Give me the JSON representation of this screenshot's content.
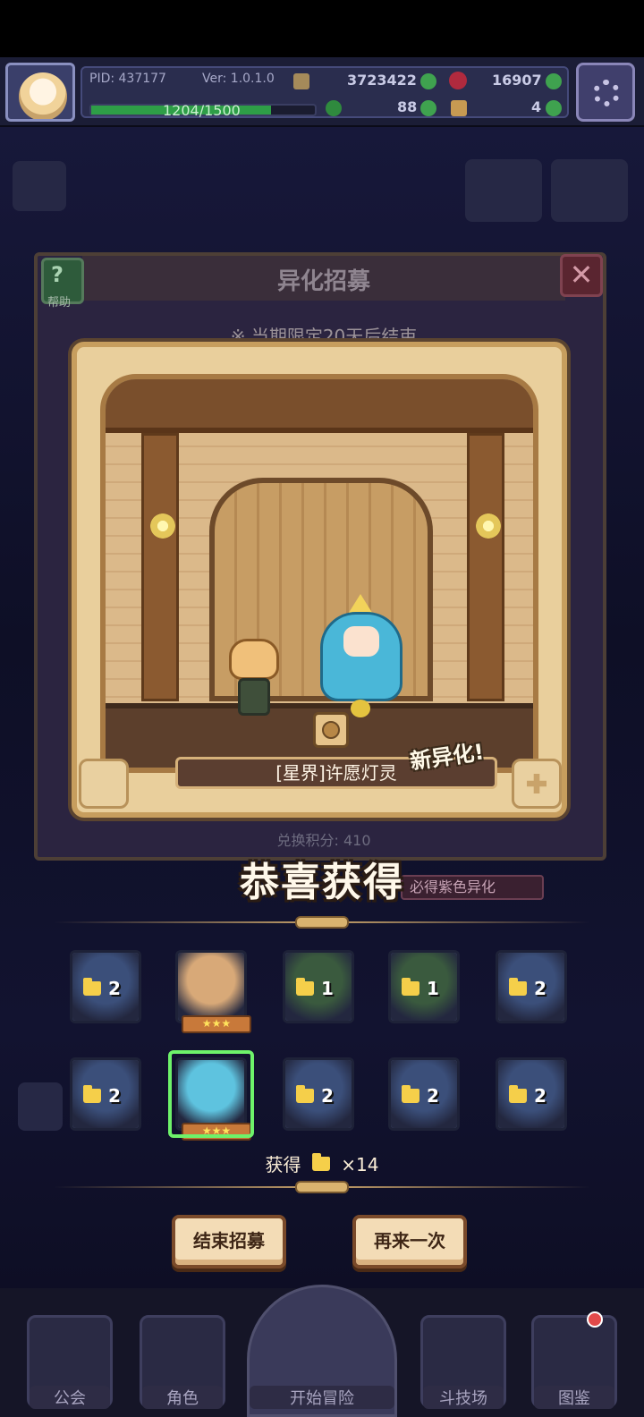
{
  "hud": {
    "pid": "PID: 437177",
    "version": "Ver: 1.0.1.0",
    "gold": "3723422",
    "gems": "16907",
    "exp_text": "1204/1500",
    "exp_progress": 0.8027,
    "clover": "88",
    "key": "4"
  },
  "recruit": {
    "title": "异化招募",
    "help_label": "帮助",
    "close_label": "✕",
    "period": "※ 当期限定20天后结束",
    "exchange_points": "兑换积分: 410",
    "purple_badge": "必得紫色异化"
  },
  "popup": {
    "character_name": "[星界]许愿灯灵",
    "new_tag": "新异化!"
  },
  "congrats": "恭喜获得",
  "rewards": [
    {
      "count": "2",
      "color": "#3b4f7a",
      "stars": "",
      "selected": false
    },
    {
      "count": "",
      "color": "#d8a978",
      "stars": "★★★",
      "selected": false
    },
    {
      "count": "1",
      "color": "#3a5a3e",
      "stars": "",
      "selected": false
    },
    {
      "count": "1",
      "color": "#3a5a3e",
      "stars": "",
      "selected": false
    },
    {
      "count": "2",
      "color": "#3b4f7a",
      "stars": "",
      "selected": false
    },
    {
      "count": "2",
      "color": "#3b4f7a",
      "stars": "",
      "selected": false
    },
    {
      "count": "",
      "color": "#5ec3df",
      "stars": "★★★",
      "selected": true
    },
    {
      "count": "2",
      "color": "#3b4f7a",
      "stars": "",
      "selected": false
    },
    {
      "count": "2",
      "color": "#3b4f7a",
      "stars": "",
      "selected": false
    },
    {
      "count": "2",
      "color": "#3b4f7a",
      "stars": "",
      "selected": false
    }
  ],
  "obtain": {
    "label": "获得",
    "count": "×14"
  },
  "buttons": {
    "end_recruit": "结束招募",
    "again": "再来一次"
  },
  "nav": {
    "guild": "公会",
    "character": "角色",
    "adventure": "开始冒险",
    "arena": "斗技场",
    "codex": "图鉴"
  },
  "colors": {
    "accent_gold": "#c9a36a",
    "selected_green": "#6ef26a",
    "exp_green": "#2e9e47"
  }
}
